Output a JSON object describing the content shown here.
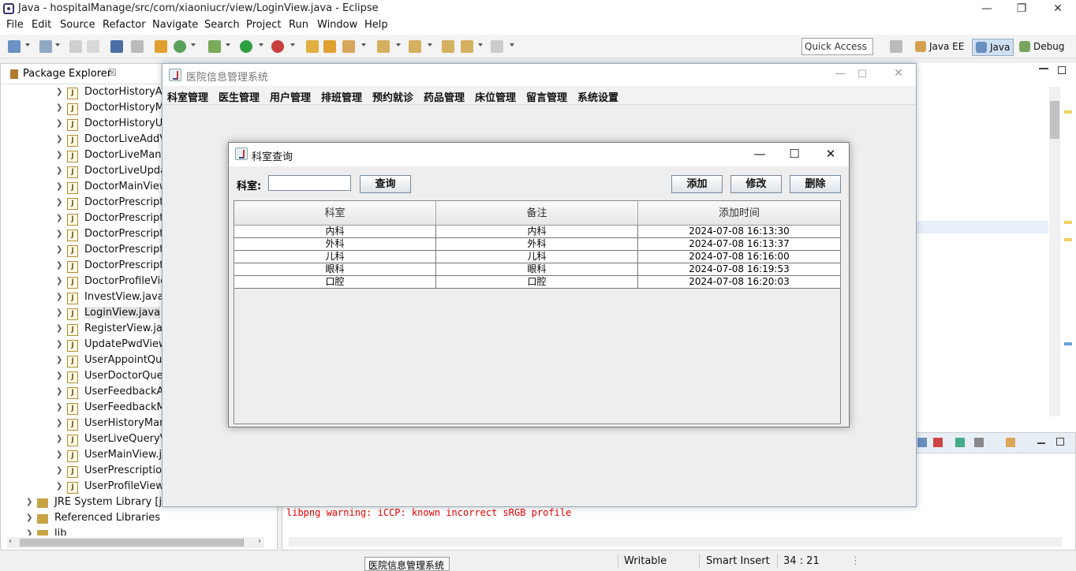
{
  "window": {
    "title": "Java - hospitalManage/src/com/xiaoniucr/view/LoginView.java - Eclipse",
    "minimize": "—",
    "restore": "❐",
    "close": "✕"
  },
  "menubar": [
    "File",
    "Edit",
    "Source",
    "Refactor",
    "Navigate",
    "Search",
    "Project",
    "Run",
    "Window",
    "Help"
  ],
  "toolbar": {
    "quick_access": "Quick Access",
    "perspectives": [
      "Java EE",
      "Java",
      "Debug"
    ]
  },
  "package_explorer": {
    "title": "Package Explorer",
    "close": "☒",
    "items": [
      "DoctorHistoryAdd",
      "DoctorHistoryMa",
      "DoctorHistoryUpc",
      "DoctorLiveAddVie",
      "DoctorLiveManag",
      "DoctorLiveUpdate",
      "DoctorMainView.j",
      "DoctorPrescriptio",
      "DoctorPrescriptio",
      "DoctorPrescriptio",
      "DoctorPrescriptio",
      "DoctorPrescriptio",
      "DoctorProfileView",
      "InvestView.java",
      "LoginView.java",
      "RegisterView.java",
      "UpdatePwdView.j",
      "UserAppointQuer",
      "UserDoctorQuery",
      "UserFeedbackAdc",
      "UserFeedbackMa",
      "UserHistoryMana",
      "UserLiveQueryVie",
      "UserMainView.jav",
      "UserPrescriptionC",
      "UserProfileView.ja"
    ],
    "roots": [
      "JRE System Library [jre1.",
      "Referenced Libraries",
      "lib"
    ]
  },
  "console": {
    "log": "libpng warning: iCCP: known incorrect sRGB profile"
  },
  "status": {
    "writable": "Writable",
    "insert": "Smart Insert",
    "position": "34 : 21",
    "taskbar": "医院信息管理系统"
  },
  "app": {
    "title": "医院信息管理系统",
    "menus": [
      "科室管理",
      "医生管理",
      "用户管理",
      "排班管理",
      "预约就诊",
      "药品管理",
      "床位管理",
      "留言管理",
      "系统设置"
    ]
  },
  "dialog": {
    "title": "科室查询",
    "label": "科室:",
    "input_value": "",
    "query": "查询",
    "add": "添加",
    "edit": "修改",
    "delete": "删除",
    "columns": [
      "科室",
      "备注",
      "添加时间"
    ],
    "rows": [
      [
        "内科",
        "内科",
        "2024-07-08 16:13:30"
      ],
      [
        "外科",
        "外科",
        "2024-07-08 16:13:37"
      ],
      [
        "儿科",
        "儿科",
        "2024-07-08 16:16:00"
      ],
      [
        "眼科",
        "眼科",
        "2024-07-08 16:19:53"
      ],
      [
        "口腔",
        "口腔",
        "2024-07-08 16:20:03"
      ]
    ]
  }
}
